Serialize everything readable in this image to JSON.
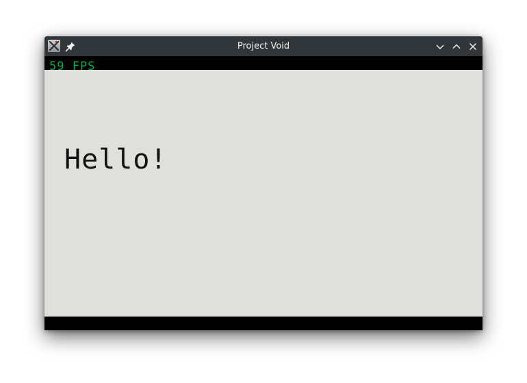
{
  "window": {
    "title": "Project Void"
  },
  "icons": {
    "app": "x-app-icon",
    "pin": "pin-icon",
    "minimize": "chevron-down-icon",
    "maximize": "chevron-up-icon",
    "close": "close-icon"
  },
  "game": {
    "fps_text": "59 FPS",
    "message": "Hello!"
  },
  "colors": {
    "titlebar": "#31363b",
    "title_text": "#eff0f1",
    "letterbox": "#000000",
    "game_background": "#dfe0db",
    "fps_text": "#00b050",
    "message_text": "#111111"
  }
}
